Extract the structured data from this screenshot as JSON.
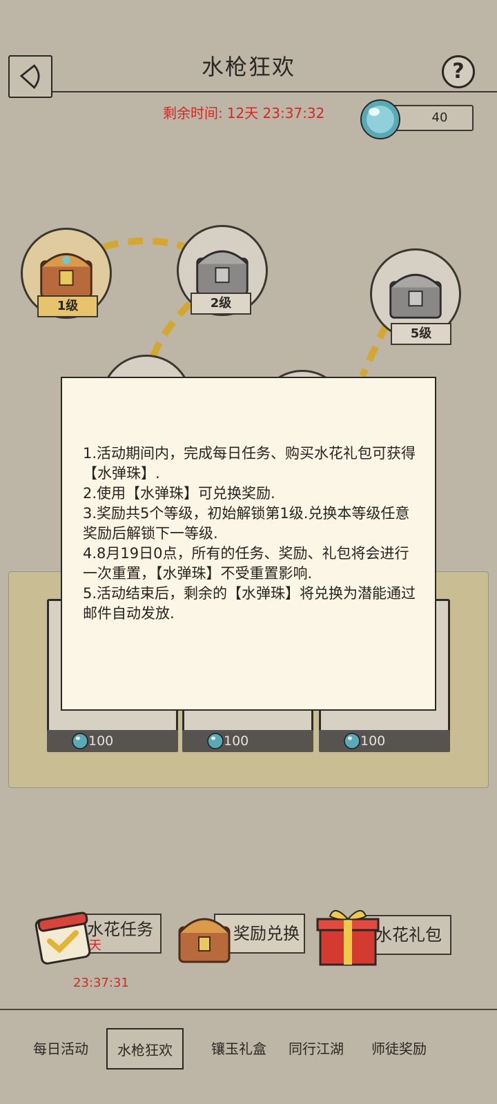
{
  "header": {
    "title": "水枪狂欢",
    "timer_label": "剩余时间:",
    "timer_value": "12天 23:37:32",
    "pearl_count": "40"
  },
  "levels": [
    {
      "label": "1级",
      "state": "unlocked"
    },
    {
      "label": "2级",
      "state": "locked"
    },
    {
      "label": "5级",
      "state": "locked"
    }
  ],
  "rewards": [
    {
      "cost": "100"
    },
    {
      "cost": "100"
    },
    {
      "cost": "100"
    }
  ],
  "modal": {
    "lines": [
      "1.活动期间内，完成每日任务、购买水花礼包可获得【水弹珠】.",
      "2.使用【水弹珠】可兑换奖励.",
      "3.奖励共5个等级，初始解锁第1级.兑换本等级任意奖励后解锁下一等级.",
      "4.8月19日0点，所有的任务、奖励、礼包将会进行一次重置，【水弹珠】不受重置影响.",
      "5.活动结束后，剩余的【水弹珠】将兑换为潜能通过邮件自动发放."
    ]
  },
  "actions": {
    "tasks_label": "水花任务",
    "tasks_timer": "11天 23:37:31",
    "exchange_label": "奖励兑换",
    "gift_label": "水花礼包"
  },
  "tabs": [
    "每日活动",
    "水枪狂欢",
    "镶玉礼盒",
    "同行江湖",
    "师徒奖励"
  ],
  "colors": {
    "background": "#bdb6a6",
    "timer_red": "#d12a22",
    "path_gold": "#d4a830",
    "modal_bg": "#fcf6e6"
  }
}
